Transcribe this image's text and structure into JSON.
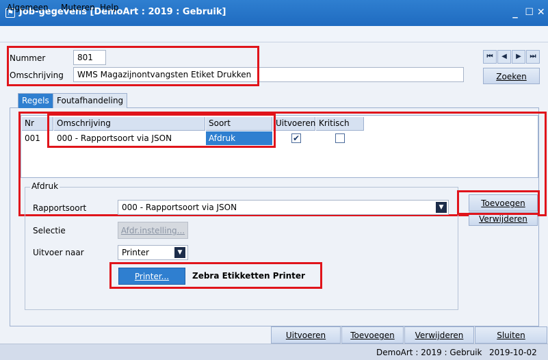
{
  "window": {
    "title": "Job-gegevens  [DemoArt : 2019 : Gebruik]",
    "minimize": "_",
    "close": "☐ ✕"
  },
  "menu": [
    "Algemeen",
    "Muteren",
    "Help"
  ],
  "header": {
    "nummer_label": "Nummer",
    "nummer_value": "801",
    "omschrijving_label": "Omschrijving",
    "omschrijving_value": "WMS Magazijnontvangsten Etiket Drukken",
    "nav_first": "⏮",
    "nav_prev": "◀",
    "nav_next": "▶",
    "nav_last": "⏭",
    "search_label": "Zoeken"
  },
  "tabs": [
    {
      "label": "Regels",
      "active": true
    },
    {
      "label": "Foutafhandeling",
      "active": false
    }
  ],
  "grid": {
    "columns": [
      "Nr",
      "Omschrijving",
      "Soort",
      "Uitvoeren",
      "Kritisch"
    ],
    "rows": [
      {
        "nr": "001",
        "omschrijving": "000 - Rapportsoort via JSON",
        "soort": "Afdruk",
        "uitvoeren": "✔",
        "kritisch": ""
      }
    ]
  },
  "afdruk": {
    "group_label": "Afdruk",
    "rapportsoort_label": "Rapportsoort",
    "rapportsoort_value": "000 - Rapportsoort via JSON",
    "selectie_label": "Selectie",
    "selectie_button": "Afdr.instelling...",
    "uitvoer_label": "Uitvoer naar",
    "uitvoer_value": "Printer",
    "printer_button": "Printer...",
    "printer_name": "Zebra Etikketten Printer"
  },
  "side_buttons": {
    "add": "Toevoegen",
    "remove": "Verwijderen"
  },
  "bottom_buttons": [
    "Uitvoeren",
    "Toevoegen",
    "Verwijderen",
    "Sluiten"
  ],
  "status": {
    "context": "DemoArt : 2019 : Gebruik",
    "date": "2019-10-02"
  },
  "colors": {
    "accent": "#2f7fd0",
    "highlight": "#e0141b"
  }
}
